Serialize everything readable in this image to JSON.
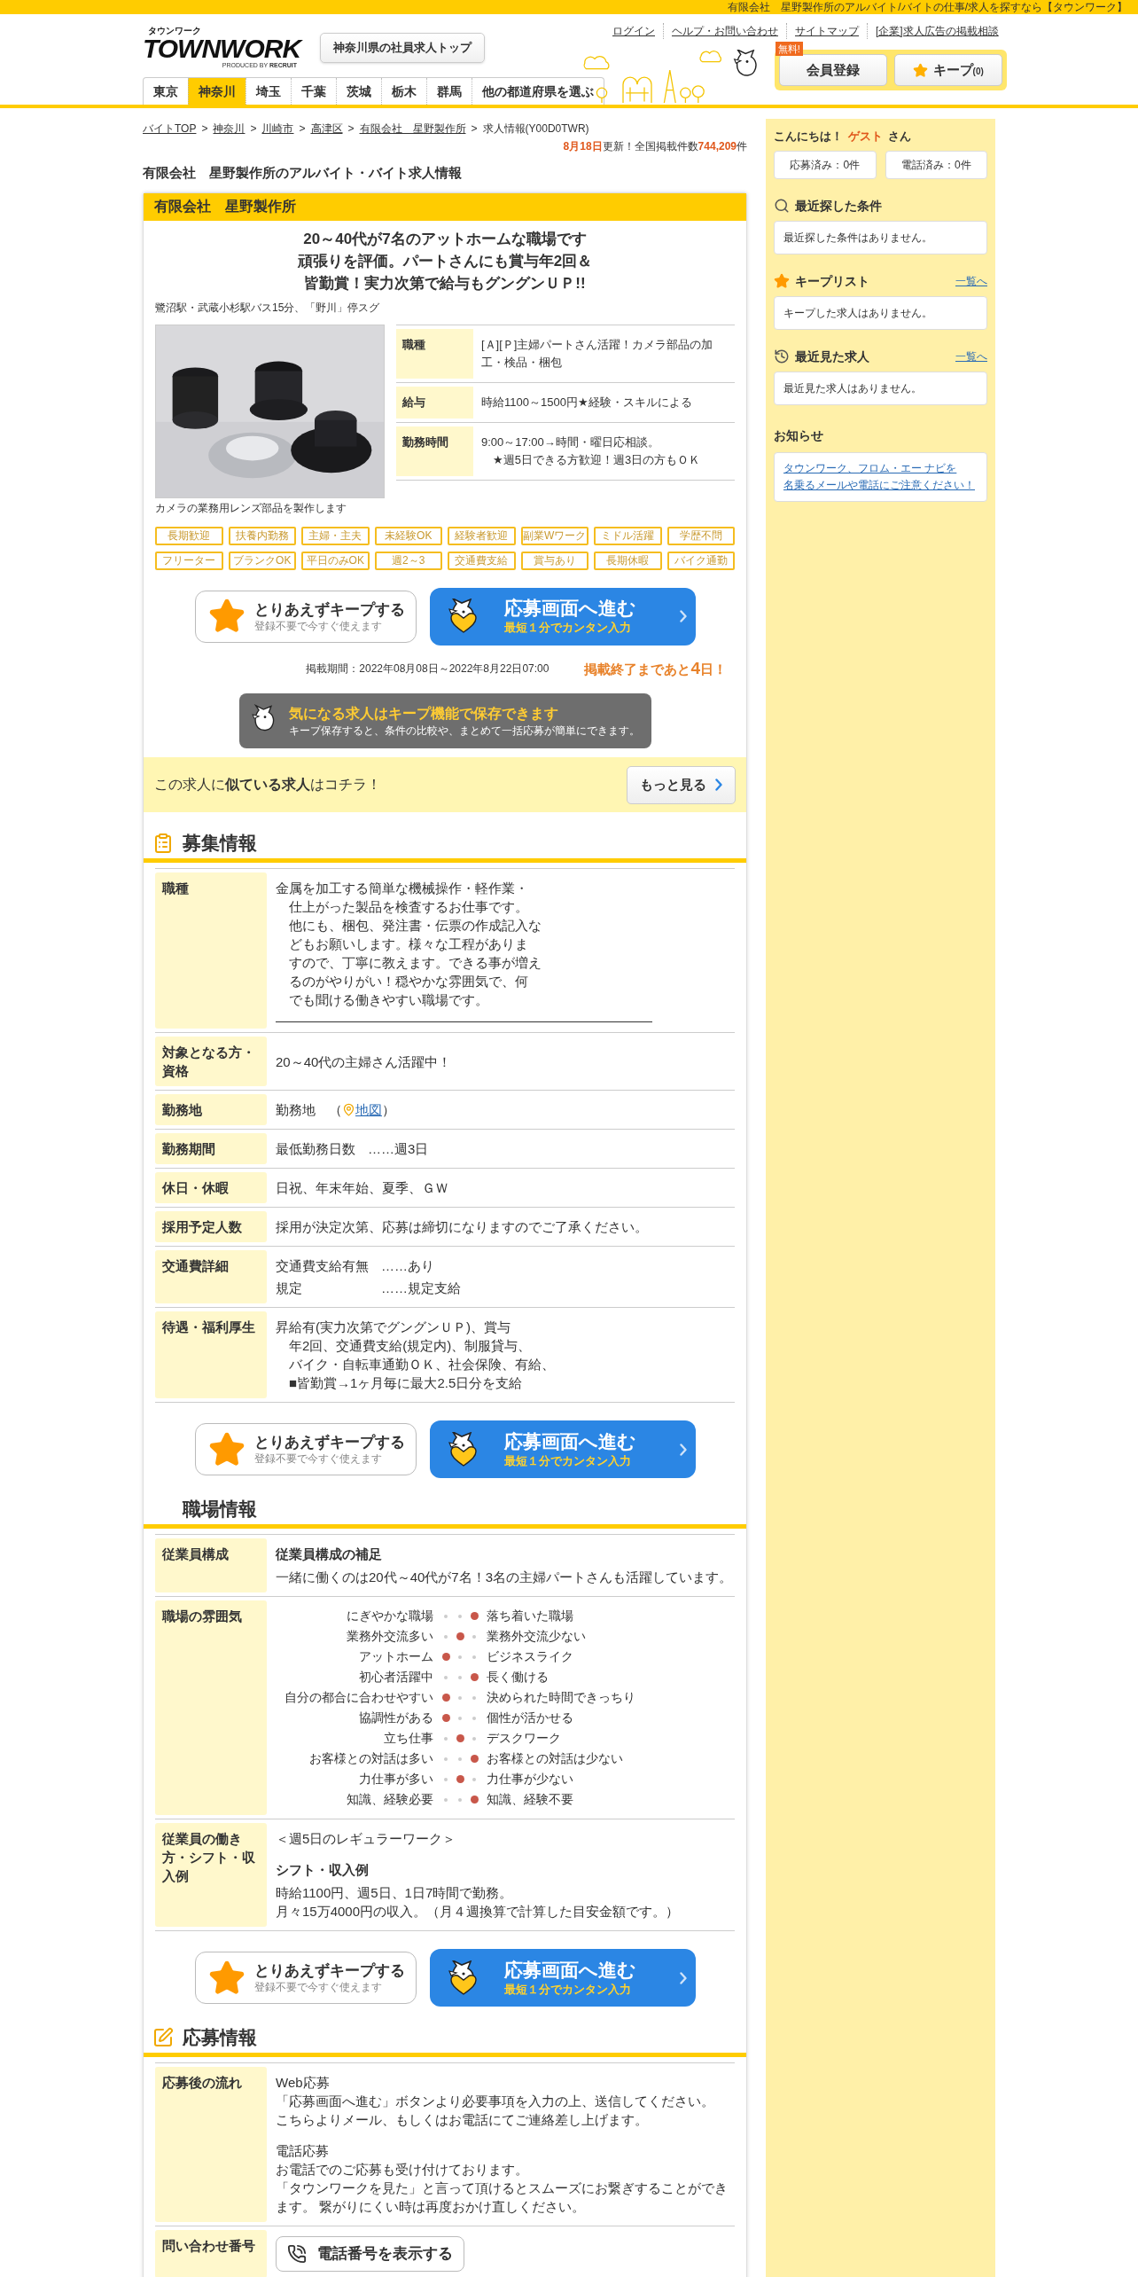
{
  "top_strip": "有限会社　星野製作所のアルバイト/バイトの仕事/求人を探すなら【タウンワーク】",
  "header": {
    "logo": {
      "kana": "タウンワーク",
      "name": "TOWNWORK",
      "producer_prefix": "PRODUCED BY",
      "producer": "RECRUIT"
    },
    "prefecture_top_button": "神奈川県の社員求人トップ",
    "links": [
      "ログイン",
      "ヘルプ・お問い合わせ",
      "サイトマップ",
      "[企業]求人広告の掲載相談"
    ],
    "register_button": {
      "badge": "無料!",
      "label": "会員登録"
    },
    "keep_button": {
      "label": "キープ",
      "count": "(0)"
    }
  },
  "prefecture_tabs": [
    {
      "label": "東京",
      "selected": false
    },
    {
      "label": "神奈川",
      "selected": true
    },
    {
      "label": "埼玉",
      "selected": false
    },
    {
      "label": "千葉",
      "selected": false
    },
    {
      "label": "茨城",
      "selected": false
    },
    {
      "label": "栃木",
      "selected": false
    },
    {
      "label": "群馬",
      "selected": false
    },
    {
      "label": "他の都道府県を選ぶ",
      "selected": false
    }
  ],
  "breadcrumb": {
    "separator": ">",
    "items": [
      {
        "label": "バイトTOP",
        "link": true
      },
      {
        "label": "神奈川",
        "link": true
      },
      {
        "label": "川崎市",
        "link": true
      },
      {
        "label": "高津区",
        "link": true
      },
      {
        "label": "有限会社　星野製作所",
        "link": true
      },
      {
        "label": "求人情報(Y00D0TWR)",
        "link": false
      }
    ]
  },
  "update_info": {
    "date": "8月18日",
    "text": "更新！全国掲載件数",
    "count": "744,209",
    "unit": "件"
  },
  "page_title": "有限会社　星野製作所のアルバイト・バイト求人情報",
  "job": {
    "company": "有限会社　星野製作所",
    "headline": [
      "20～40代が7名のアットホームな職場です",
      "頑張りを評価。パートさんにも賞与年2回＆",
      "皆勤賞！実力次第で給与もグングンＵＰ!!"
    ],
    "access": "鷺沼駅・武蔵小杉駅バス15分、「野川」停スグ",
    "photo": {
      "kind": "picture"
    },
    "photo_caption": "カメラの業務用レンズ部品を製作します",
    "summary": [
      {
        "label": "職種",
        "lines": [
          "[Ａ][Ｐ]主婦パートさん活躍！カメラ部品の加工・検品・梱包"
        ]
      },
      {
        "label": "給与",
        "lines": [
          "時給1100～1500円★経験・スキルによる"
        ]
      },
      {
        "label": "勤務時間",
        "lines": [
          "9:00～17:00→時間・曜日応相談。",
          "★週5日できる方歓迎！週3日の方もＯＫ"
        ],
        "indent": true
      }
    ],
    "tags": [
      "長期歓迎",
      "扶養内勤務",
      "主婦・主夫",
      "未経験OK",
      "経験者歓迎",
      "副業Wワーク",
      "ミドル活躍",
      "学歴不問",
      "フリーター",
      "ブランクOK",
      "平日のみOK",
      "週2～3",
      "交通費支給",
      "賞与あり",
      "長期休暇",
      "バイク通勤"
    ],
    "actions": {
      "keep": {
        "label": "とりあえずキープする",
        "sub": "登録不要で今すぐ使えます"
      },
      "apply": {
        "label": "応募画面へ進む",
        "sub": "最短１分でカンタン入力"
      }
    },
    "period": "掲載期間：2022年08月08日～2022年8月22日07:00",
    "deadline": {
      "prefix": "掲載終了まであと",
      "days": "4",
      "suffix": "日！"
    },
    "keep_banner": {
      "title": "気になる求人はキープ機能で保存できます",
      "text": "キープ保存すると、条件の比較や、まとめて一括応募が簡単にできます。"
    }
  },
  "similar": {
    "text": "この求人に**似ている求人**はコチラ！",
    "button": "もっと見る"
  },
  "sections": [
    {
      "title": "募集情報",
      "rows": [
        {
          "label": "職種",
          "blocks": [
            {
              "kind": "text",
              "indent": true,
              "rule": true,
              "lines": [
                "金属を加工する簡単な機械操作・軽作業・",
                "仕上がった製品を検査するお仕事です。",
                "他にも、梱包、発注書・伝票の作成記入な",
                "どもお願いします。様々な工程がありま",
                "すので、丁寧に教えます。できる事が増え",
                "るのがやりがい！穏やかな雰囲気で、何",
                "でも聞ける働きやすい職場です。"
              ]
            }
          ]
        },
        {
          "label": "対象となる方・資格",
          "blocks": [
            {
              "kind": "text",
              "lines": [
                "20～40代の主婦さん活躍中！"
              ]
            }
          ]
        },
        {
          "label": "勤務地",
          "blocks": [
            {
              "kind": "map",
              "text": "勤務地　（",
              "link": "地図",
              "suffix": "）"
            }
          ]
        },
        {
          "label": "勤務期間",
          "blocks": [
            {
              "kind": "pairs",
              "items": [
                {
                  "key": "最低勤務日数",
                  "value": "……週3日"
                }
              ]
            }
          ]
        },
        {
          "label": "休日・休暇",
          "blocks": [
            {
              "kind": "text",
              "lines": [
                "日祝、年末年始、夏季、ＧＷ"
              ]
            }
          ]
        },
        {
          "label": "採用予定人数",
          "blocks": [
            {
              "kind": "text",
              "lines": [
                "採用が決定次第、応募は締切になりますのでご了承ください。"
              ]
            }
          ]
        },
        {
          "label": "交通費詳細",
          "blocks": [
            {
              "kind": "pairs",
              "items": [
                {
                  "key": "交通費支給有無",
                  "value": "……あり"
                },
                {
                  "key": "規定",
                  "value": "……規定支給"
                }
              ]
            }
          ]
        },
        {
          "label": "待遇・福利厚生",
          "blocks": [
            {
              "kind": "text",
              "indent": true,
              "lines": [
                "昇給有(実力次第でグングンＵＰ)、賞与",
                "年2回、交通費支給(規定内)、制服貸与、",
                "バイク・自転車通勤ＯＫ、社会保険、有給、",
                "■皆勤賞→1ヶ月毎に最大2.5日分を支給"
              ]
            }
          ]
        }
      ],
      "actions": {
        "keep": {
          "label": "とりあえずキープする",
          "sub": "登録不要で今すぐ使えます"
        },
        "apply": {
          "label": "応募画面へ進む",
          "sub": "最短１分でカンタン入力"
        }
      }
    },
    {
      "title": "職場情報",
      "rows": [
        {
          "label": "従業員構成",
          "blocks": [
            {
              "kind": "heading",
              "text": "従業員構成の補足"
            },
            {
              "kind": "text",
              "lines": [
                "一緒に働くのは20代～40代が7名！3名の主婦パートさんも活躍しています。"
              ]
            }
          ]
        },
        {
          "label": "職場の雰囲気",
          "blocks": [
            {
              "kind": "atmosphere",
              "items": [
                {
                  "left": "にぎやかな職場",
                  "right": "落ち着いた職場",
                  "dots": [
                    {
                      "selected": false
                    },
                    {
                      "selected": false
                    },
                    {
                      "selected": true
                    }
                  ]
                },
                {
                  "left": "業務外交流多い",
                  "right": "業務外交流少ない",
                  "dots": [
                    {
                      "selected": false
                    },
                    {
                      "selected": true
                    },
                    {
                      "selected": false
                    }
                  ]
                },
                {
                  "left": "アットホーム",
                  "right": "ビジネスライク",
                  "dots": [
                    {
                      "selected": true
                    },
                    {
                      "selected": false
                    },
                    {
                      "selected": false
                    }
                  ]
                },
                {
                  "left": "初心者活躍中",
                  "right": "長く働ける",
                  "dots": [
                    {
                      "selected": false
                    },
                    {
                      "selected": false
                    },
                    {
                      "selected": true
                    }
                  ]
                },
                {
                  "left": "自分の都合に合わせやすい",
                  "right": "決められた時間できっちり",
                  "dots": [
                    {
                      "selected": true
                    },
                    {
                      "selected": false
                    },
                    {
                      "selected": false
                    }
                  ]
                },
                {
                  "left": "協調性がある",
                  "right": "個性が活かせる",
                  "dots": [
                    {
                      "selected": true
                    },
                    {
                      "selected": false
                    },
                    {
                      "selected": false
                    }
                  ]
                },
                {
                  "left": "立ち仕事",
                  "right": "デスクワーク",
                  "dots": [
                    {
                      "selected": false
                    },
                    {
                      "selected": true
                    },
                    {
                      "selected": false
                    }
                  ]
                },
                {
                  "left": "お客様との対話は多い",
                  "right": "お客様との対話は少ない",
                  "dots": [
                    {
                      "selected": false
                    },
                    {
                      "selected": false
                    },
                    {
                      "selected": true
                    }
                  ]
                },
                {
                  "left": "力仕事が多い",
                  "right": "力仕事が少ない",
                  "dots": [
                    {
                      "selected": false
                    },
                    {
                      "selected": true
                    },
                    {
                      "selected": false
                    }
                  ]
                },
                {
                  "left": "知識、経験必要",
                  "right": "知識、経験不要",
                  "dots": [
                    {
                      "selected": false
                    },
                    {
                      "selected": false
                    },
                    {
                      "selected": true
                    }
                  ]
                }
              ]
            }
          ]
        },
        {
          "label": "従業員の働き方・シフト・収入例",
          "blocks": [
            {
              "kind": "text",
              "lines": [
                "＜週5日のレギュラーワーク＞"
              ]
            },
            {
              "kind": "heading",
              "text": "シフト・収入例"
            },
            {
              "kind": "text",
              "lines": [
                "時給1100円、週5日、1日7時間で勤務。",
                "月々15万4000円の収入。（月４週換算で計算した目安金額です。）"
              ]
            }
          ]
        }
      ],
      "actions": {
        "keep": {
          "label": "とりあえずキープする",
          "sub": "登録不要で今すぐ使えます"
        },
        "apply": {
          "label": "応募画面へ進む",
          "sub": "最短１分でカンタン入力"
        }
      }
    },
    {
      "title": "応募情報",
      "rows": [
        {
          "label": "応募後の流れ",
          "blocks": [
            {
              "kind": "text",
              "lines": [
                "Web応募",
                "「応募画面へ進む」ボタンより必要事項を入力の上、送信してください。",
                "こちらよりメール、もしくはお電話にてご連絡差し上げます。"
              ]
            },
            {
              "kind": "text",
              "lines": [
                "電話応募",
                "お電話でのご応募も受け付けております。",
                "「タウンワークを見た」と言って頂けるとスムーズにお繋ぎすることができます。 繋がりにくい時は再度おかけ直しください。"
              ]
            }
          ]
        },
        {
          "label": "問い合わせ番号",
          "blocks": [
            {
              "kind": "phone",
              "label": "電話番号を表示する"
            }
          ]
        }
      ]
    }
  ],
  "sidebar": {
    "greeting": {
      "prefix": "こんにちは！",
      "name": "ゲスト",
      "suffix": "さん"
    },
    "counts": [
      "応募済み：0件",
      "電話済み：0件"
    ],
    "panels": [
      {
        "kind": "search",
        "title": "最近探した条件",
        "message": "最近探した条件はありません。"
      },
      {
        "kind": "keep",
        "title": "キープリスト",
        "link": "一覧へ",
        "message": "キープした求人はありません。"
      },
      {
        "kind": "history",
        "title": "最近見た求人",
        "link": "一覧へ",
        "message": "最近見た求人はありません。"
      }
    ],
    "notice": {
      "title": "お知らせ",
      "link_lines": [
        "タウンワーク、フロム・エー ナビを",
        "名乗るメールや電話にご注意ください！"
      ]
    }
  }
}
